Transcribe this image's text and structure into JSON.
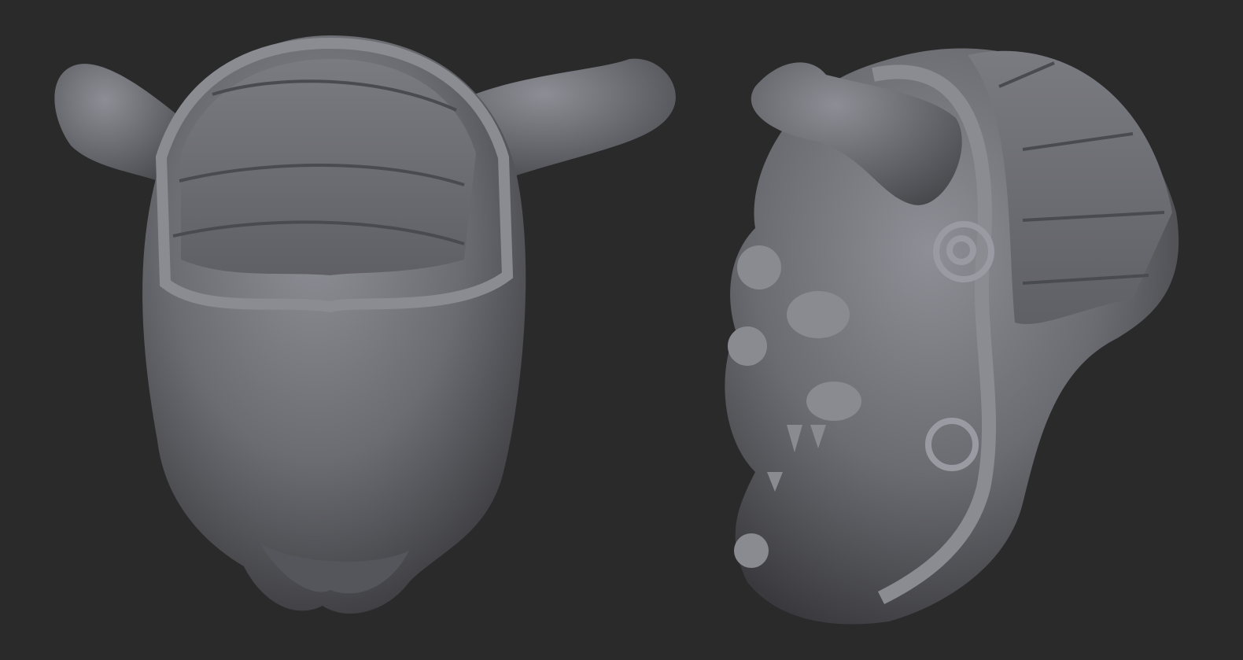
{
  "scene": {
    "background_color": "#2a2a2b",
    "material_color": "#6f6f74",
    "highlight_color": "#a9aab3",
    "shadow_color": "#2f2f32",
    "objects": [
      {
        "view": "front",
        "subject": "horned-creature-head-sculpt"
      },
      {
        "view": "side",
        "subject": "horned-creature-head-sculpt"
      }
    ]
  }
}
